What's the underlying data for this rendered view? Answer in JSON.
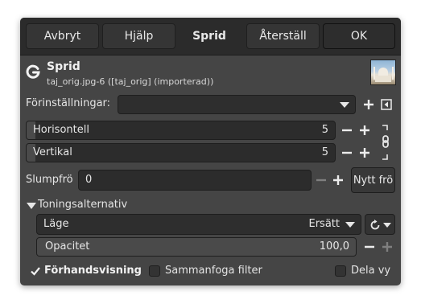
{
  "header": {
    "cancel_label": "Avbryt",
    "help_label": "Hjälp",
    "title": "Sprid",
    "reset_label": "Återställ",
    "ok_label": "OK"
  },
  "filter": {
    "name": "Sprid",
    "image_info": "taj_orig.jpg-6 ([taj_orig] (importerad))"
  },
  "presets": {
    "label": "Förinställningar:",
    "value": ""
  },
  "horizontal": {
    "label": "Horisontell",
    "value": "5",
    "level_fraction": 0.03
  },
  "vertical": {
    "label": "Vertikal",
    "value": "5",
    "level_fraction": 0.03
  },
  "seed": {
    "label": "Slumpfrö",
    "value": "0",
    "new_seed_label": "Nytt frö"
  },
  "blending": {
    "section_label": "Toningsalternativ",
    "mode_label": "Läge",
    "mode_value": "Ersätt",
    "opacity_label": "Opacitet",
    "opacity_value": "100,0",
    "opacity_fraction": 1.0
  },
  "footer": {
    "preview_label": "Förhandsvisning",
    "preview_checked": true,
    "merge_label": "Sammanfoga filter",
    "merge_checked": false,
    "split_label": "Dela vy",
    "split_checked": false
  },
  "colors": {
    "dialog_bg": "#454545",
    "header_bg": "#2b2b2b",
    "field_bg": "#2c2c2c",
    "text": "#e6e6e6"
  }
}
